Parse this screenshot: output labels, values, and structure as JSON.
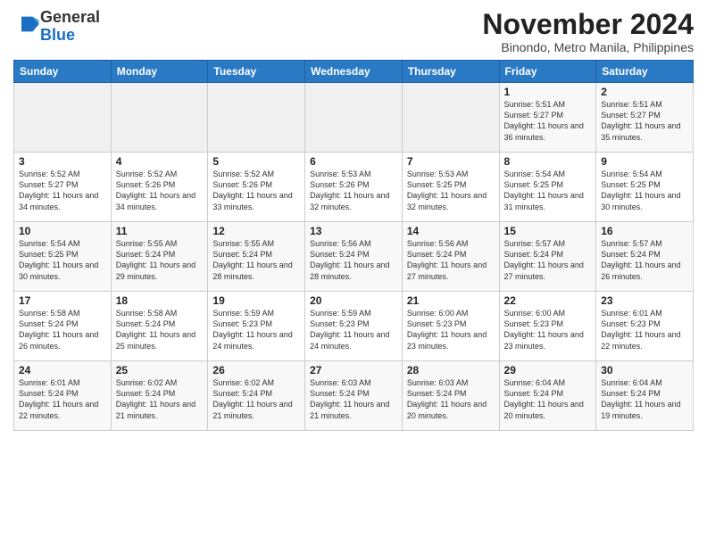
{
  "header": {
    "logo_general": "General",
    "logo_blue": "Blue",
    "month_title": "November 2024",
    "location": "Binondo, Metro Manila, Philippines"
  },
  "calendar": {
    "weekdays": [
      "Sunday",
      "Monday",
      "Tuesday",
      "Wednesday",
      "Thursday",
      "Friday",
      "Saturday"
    ],
    "weeks": [
      [
        {
          "day": "",
          "info": ""
        },
        {
          "day": "",
          "info": ""
        },
        {
          "day": "",
          "info": ""
        },
        {
          "day": "",
          "info": ""
        },
        {
          "day": "",
          "info": ""
        },
        {
          "day": "1",
          "info": "Sunrise: 5:51 AM\nSunset: 5:27 PM\nDaylight: 11 hours and 36 minutes."
        },
        {
          "day": "2",
          "info": "Sunrise: 5:51 AM\nSunset: 5:27 PM\nDaylight: 11 hours and 35 minutes."
        }
      ],
      [
        {
          "day": "3",
          "info": "Sunrise: 5:52 AM\nSunset: 5:27 PM\nDaylight: 11 hours and 34 minutes."
        },
        {
          "day": "4",
          "info": "Sunrise: 5:52 AM\nSunset: 5:26 PM\nDaylight: 11 hours and 34 minutes."
        },
        {
          "day": "5",
          "info": "Sunrise: 5:52 AM\nSunset: 5:26 PM\nDaylight: 11 hours and 33 minutes."
        },
        {
          "day": "6",
          "info": "Sunrise: 5:53 AM\nSunset: 5:26 PM\nDaylight: 11 hours and 32 minutes."
        },
        {
          "day": "7",
          "info": "Sunrise: 5:53 AM\nSunset: 5:25 PM\nDaylight: 11 hours and 32 minutes."
        },
        {
          "day": "8",
          "info": "Sunrise: 5:54 AM\nSunset: 5:25 PM\nDaylight: 11 hours and 31 minutes."
        },
        {
          "day": "9",
          "info": "Sunrise: 5:54 AM\nSunset: 5:25 PM\nDaylight: 11 hours and 30 minutes."
        }
      ],
      [
        {
          "day": "10",
          "info": "Sunrise: 5:54 AM\nSunset: 5:25 PM\nDaylight: 11 hours and 30 minutes."
        },
        {
          "day": "11",
          "info": "Sunrise: 5:55 AM\nSunset: 5:24 PM\nDaylight: 11 hours and 29 minutes."
        },
        {
          "day": "12",
          "info": "Sunrise: 5:55 AM\nSunset: 5:24 PM\nDaylight: 11 hours and 28 minutes."
        },
        {
          "day": "13",
          "info": "Sunrise: 5:56 AM\nSunset: 5:24 PM\nDaylight: 11 hours and 28 minutes."
        },
        {
          "day": "14",
          "info": "Sunrise: 5:56 AM\nSunset: 5:24 PM\nDaylight: 11 hours and 27 minutes."
        },
        {
          "day": "15",
          "info": "Sunrise: 5:57 AM\nSunset: 5:24 PM\nDaylight: 11 hours and 27 minutes."
        },
        {
          "day": "16",
          "info": "Sunrise: 5:57 AM\nSunset: 5:24 PM\nDaylight: 11 hours and 26 minutes."
        }
      ],
      [
        {
          "day": "17",
          "info": "Sunrise: 5:58 AM\nSunset: 5:24 PM\nDaylight: 11 hours and 26 minutes."
        },
        {
          "day": "18",
          "info": "Sunrise: 5:58 AM\nSunset: 5:24 PM\nDaylight: 11 hours and 25 minutes."
        },
        {
          "day": "19",
          "info": "Sunrise: 5:59 AM\nSunset: 5:23 PM\nDaylight: 11 hours and 24 minutes."
        },
        {
          "day": "20",
          "info": "Sunrise: 5:59 AM\nSunset: 5:23 PM\nDaylight: 11 hours and 24 minutes."
        },
        {
          "day": "21",
          "info": "Sunrise: 6:00 AM\nSunset: 5:23 PM\nDaylight: 11 hours and 23 minutes."
        },
        {
          "day": "22",
          "info": "Sunrise: 6:00 AM\nSunset: 5:23 PM\nDaylight: 11 hours and 23 minutes."
        },
        {
          "day": "23",
          "info": "Sunrise: 6:01 AM\nSunset: 5:23 PM\nDaylight: 11 hours and 22 minutes."
        }
      ],
      [
        {
          "day": "24",
          "info": "Sunrise: 6:01 AM\nSunset: 5:24 PM\nDaylight: 11 hours and 22 minutes."
        },
        {
          "day": "25",
          "info": "Sunrise: 6:02 AM\nSunset: 5:24 PM\nDaylight: 11 hours and 21 minutes."
        },
        {
          "day": "26",
          "info": "Sunrise: 6:02 AM\nSunset: 5:24 PM\nDaylight: 11 hours and 21 minutes."
        },
        {
          "day": "27",
          "info": "Sunrise: 6:03 AM\nSunset: 5:24 PM\nDaylight: 11 hours and 21 minutes."
        },
        {
          "day": "28",
          "info": "Sunrise: 6:03 AM\nSunset: 5:24 PM\nDaylight: 11 hours and 20 minutes."
        },
        {
          "day": "29",
          "info": "Sunrise: 6:04 AM\nSunset: 5:24 PM\nDaylight: 11 hours and 20 minutes."
        },
        {
          "day": "30",
          "info": "Sunrise: 6:04 AM\nSunset: 5:24 PM\nDaylight: 11 hours and 19 minutes."
        }
      ]
    ]
  }
}
